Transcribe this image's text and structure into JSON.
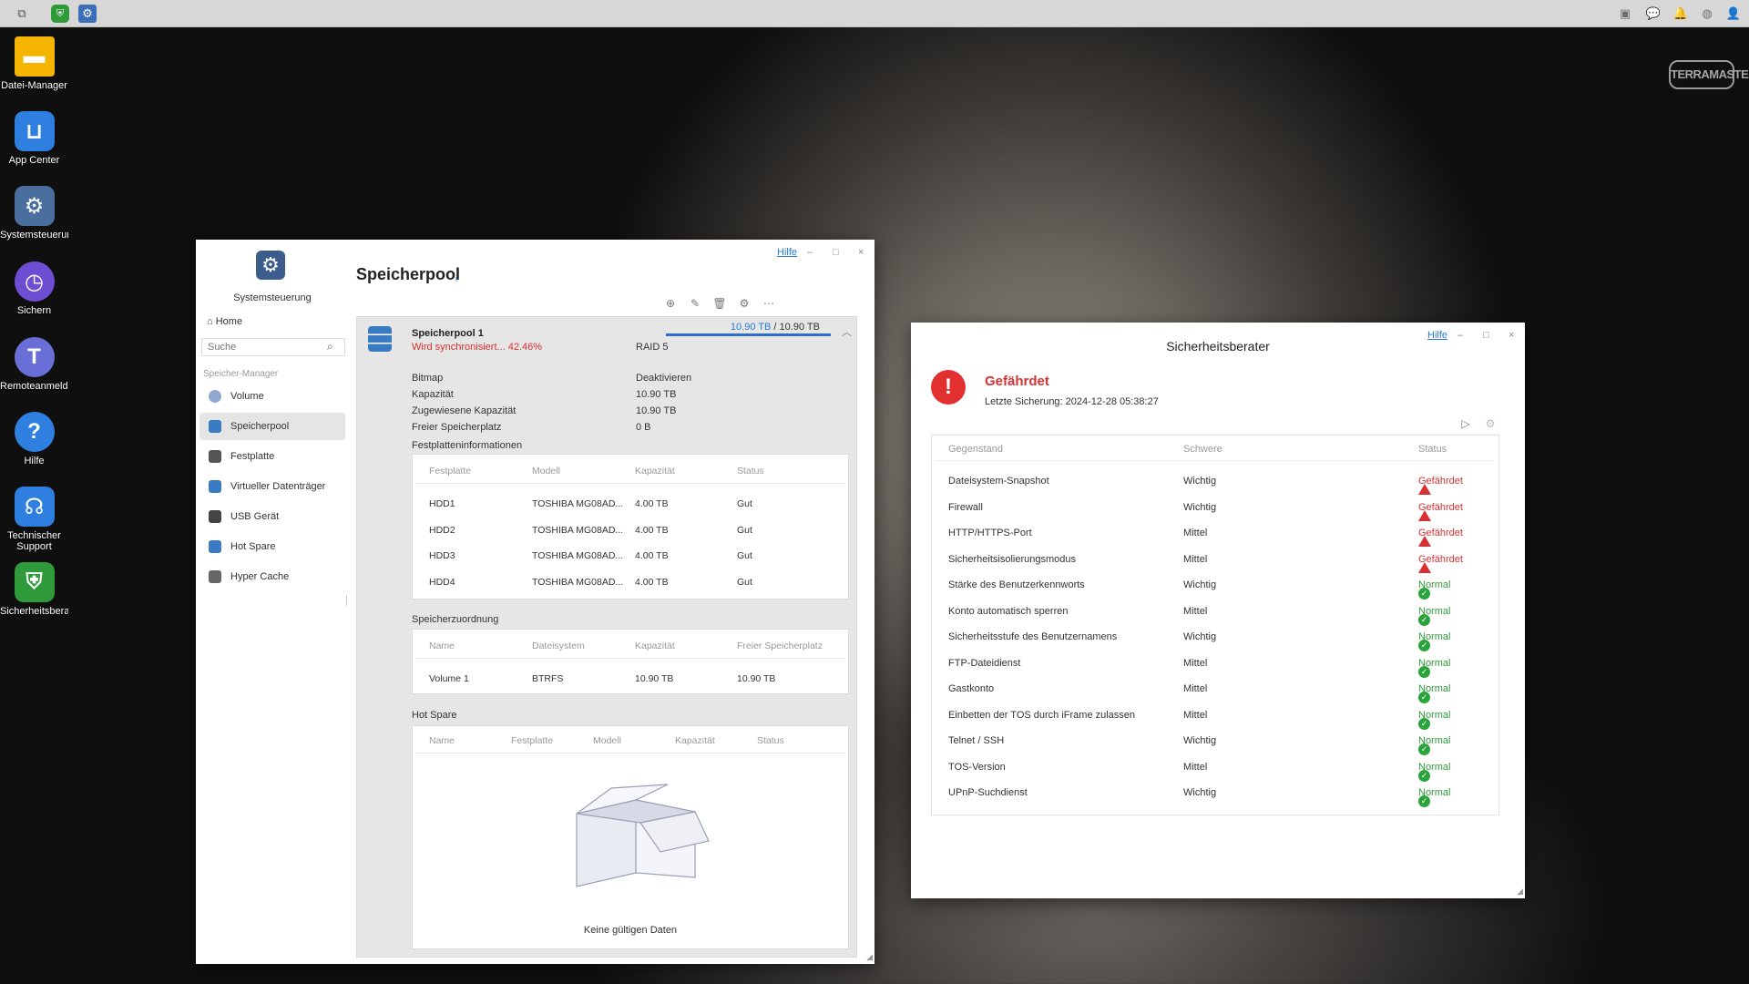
{
  "desktop": {
    "icons": [
      {
        "label": "Datei-Manager",
        "icon": "folder-icon",
        "color": "#f5b400"
      },
      {
        "label": "App Center",
        "icon": "shopping-bag-icon",
        "color": "#2f7fe0"
      },
      {
        "label": "Systemsteuerun",
        "icon": "gear-icon",
        "color": "#4a6f9e"
      },
      {
        "label": "Sichern",
        "icon": "backup-clock-icon",
        "color": "#6e4fd4"
      },
      {
        "label": "Remoteanmeldu",
        "icon": "cloud-t-icon",
        "color": "#6a6fd8"
      },
      {
        "label": "Hilfe",
        "icon": "help-question-icon",
        "color": "#2f7fe0"
      },
      {
        "label": "Technischer Support",
        "icon": "headset-icon",
        "color": "#2f7fe0"
      },
      {
        "label": "Sicherheitsberal",
        "icon": "shield-icon",
        "color": "#2f9a3a"
      }
    ],
    "brand": "TERRAMASTER"
  },
  "storage_window": {
    "help": "Hilfe",
    "sidebar": {
      "title": "Systemsteuerung",
      "home": "Home",
      "search_placeholder": "Suche",
      "section": "Speicher-Manager",
      "items": [
        {
          "label": "Volume",
          "icon": "pie-chart-icon",
          "active": false
        },
        {
          "label": "Speicherpool",
          "icon": "database-icon",
          "active": true
        },
        {
          "label": "Festplatte",
          "icon": "hard-disk-icon",
          "active": false
        },
        {
          "label": "Virtueller Datenträger",
          "icon": "virtual-disk-icon",
          "active": false
        },
        {
          "label": "USB Gerät",
          "icon": "usb-icon",
          "active": false
        },
        {
          "label": "Hot Spare",
          "icon": "hot-spare-icon",
          "active": false
        },
        {
          "label": "Hyper Cache",
          "icon": "cache-icon",
          "active": false
        }
      ]
    },
    "page_title": "Speicherpool",
    "pool": {
      "name": "Speicherpool 1",
      "sync_status": "Wird synchronisiert... 42.46%",
      "raid": "RAID 5",
      "used_capacity": "10.90 TB",
      "separator": "/",
      "total_capacity": "10.90 TB",
      "bar_fraction": 1.0,
      "details": [
        {
          "key": "Bitmap",
          "value": "Deaktivieren"
        },
        {
          "key": "Kapazität",
          "value": "10.90 TB"
        },
        {
          "key": "Zugewiesene Kapazität",
          "value": "10.90 TB"
        },
        {
          "key": "Freier Speicherplatz",
          "value": "0 B"
        }
      ],
      "disk_section": "Festplatteninformationen",
      "disk_headers": [
        "Festplatte",
        "Modell",
        "Kapazität",
        "Status"
      ],
      "disks": [
        [
          "HDD1",
          "TOSHIBA MG08AD...",
          "4.00 TB",
          "Gut"
        ],
        [
          "HDD2",
          "TOSHIBA MG08AD...",
          "4.00 TB",
          "Gut"
        ],
        [
          "HDD3",
          "TOSHIBA MG08AD...",
          "4.00 TB",
          "Gut"
        ],
        [
          "HDD4",
          "TOSHIBA MG08AD...",
          "4.00 TB",
          "Gut"
        ]
      ],
      "alloc_section": "Speicherzuordnung",
      "alloc_headers": [
        "Name",
        "Dateisystem",
        "Kapazität",
        "Freier Speicherplatz"
      ],
      "allocations": [
        [
          "Volume 1",
          "BTRFS",
          "10.90 TB",
          "10.90 TB"
        ]
      ],
      "hotspare_section": "Hot Spare",
      "hotspare_headers": [
        "Name",
        "Festplatte",
        "Modell",
        "Kapazität",
        "Status"
      ],
      "hotspare_empty": "Keine gültigen Daten"
    }
  },
  "advisor_window": {
    "help": "Hilfe",
    "title": "Sicherheitsberater",
    "status": "Gefährdet",
    "last_backup": "Letzte Sicherung: 2024-12-28 05:38:27",
    "headers": [
      "Gegenstand",
      "Schwere",
      "Status"
    ],
    "rows": [
      {
        "item": "Dateisystem-Snapshot",
        "severity": "Wichtig",
        "status": "Gefährdet",
        "ok": false
      },
      {
        "item": "Firewall",
        "severity": "Wichtig",
        "status": "Gefährdet",
        "ok": false
      },
      {
        "item": "HTTP/HTTPS-Port",
        "severity": "Mittel",
        "status": "Gefährdet",
        "ok": false
      },
      {
        "item": "Sicherheitsisolierungsmodus",
        "severity": "Mittel",
        "status": "Gefährdet",
        "ok": false
      },
      {
        "item": "Stärke des Benutzerkennworts",
        "severity": "Wichtig",
        "status": "Normal",
        "ok": true
      },
      {
        "item": "Konto automatisch sperren",
        "severity": "Mittel",
        "status": "Normal",
        "ok": true
      },
      {
        "item": "Sicherheitsstufe des Benutzernamens",
        "severity": "Wichtig",
        "status": "Normal",
        "ok": true
      },
      {
        "item": "FTP-Dateidienst",
        "severity": "Mittel",
        "status": "Normal",
        "ok": true
      },
      {
        "item": "Gastkonto",
        "severity": "Mittel",
        "status": "Normal",
        "ok": true
      },
      {
        "item": "Einbetten der TOS durch iFrame zulassen",
        "severity": "Mittel",
        "status": "Normal",
        "ok": true
      },
      {
        "item": "Telnet / SSH",
        "severity": "Wichtig",
        "status": "Normal",
        "ok": true
      },
      {
        "item": "TOS-Version",
        "severity": "Mittel",
        "status": "Normal",
        "ok": true
      },
      {
        "item": "UPnP-Suchdienst",
        "severity": "Wichtig",
        "status": "Normal",
        "ok": true
      }
    ],
    "colors": {
      "danger": "#d83131",
      "ok": "#2f9a3a"
    }
  }
}
